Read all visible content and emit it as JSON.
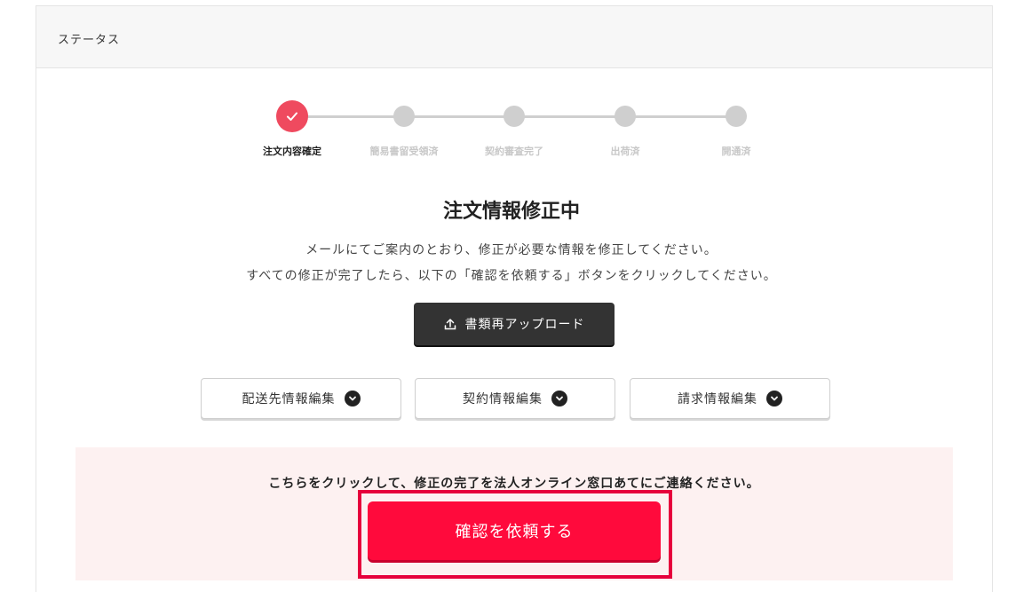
{
  "header": {
    "title": "ステータス"
  },
  "stepper": {
    "steps": [
      {
        "label": "注文内容確定",
        "state": "done"
      },
      {
        "label": "簡易書留受領済",
        "state": "pending"
      },
      {
        "label": "契約審査完了",
        "state": "pending"
      },
      {
        "label": "出荷済",
        "state": "pending"
      },
      {
        "label": "開通済",
        "state": "pending"
      }
    ],
    "active_color": "#ef4a5f",
    "inactive_color": "#cfcfcf"
  },
  "status": {
    "title": "注文情報修正中",
    "message_line1": "メールにてご案内のとおり、修正が必要な情報を修正してください。",
    "message_line2": "すべての修正が完了したら、以下の「確認を依頼する」ボタンをクリックしてください。"
  },
  "actions": {
    "upload_label": "書類再アップロード",
    "upload_icon": "upload-icon",
    "edit_buttons": [
      {
        "label": "配送先情報編集",
        "icon": "chevron-down-circle-icon"
      },
      {
        "label": "契約情報編集",
        "icon": "chevron-down-circle-icon"
      },
      {
        "label": "請求情報編集",
        "icon": "chevron-down-circle-icon"
      }
    ]
  },
  "notice": {
    "text": "こちらをクリックして、修正の完了を法人オンライン窓口あてにご連絡ください。",
    "confirm_label": "確認を依頼する",
    "accent_color": "#ff0a3c"
  }
}
